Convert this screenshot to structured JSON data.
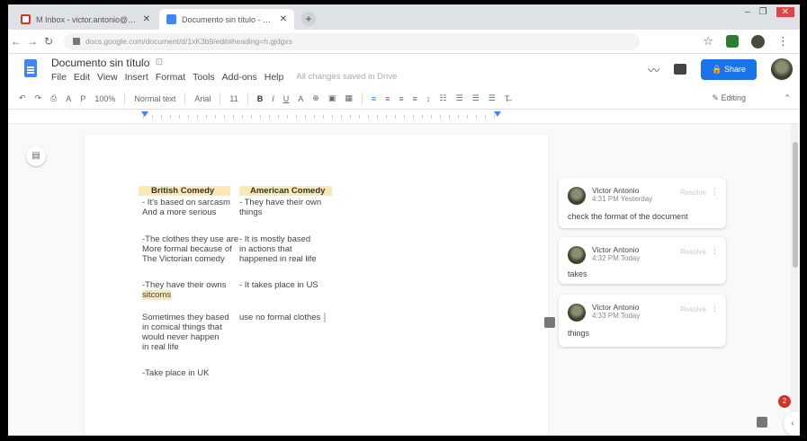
{
  "browser": {
    "tabs": [
      {
        "label": "M Inbox - victor.antonio@gmail.com",
        "active": false
      },
      {
        "label": "Documento sin título - Google Docs",
        "active": true
      }
    ],
    "new_tab": "+",
    "url": "docs.google.com/document/d/1xK3b9/edit#heading=h.gjdgxs",
    "window_controls": [
      "–",
      "❐",
      "✕"
    ]
  },
  "docs": {
    "title": "Documento sin título",
    "title_icons": "☆ ⊡",
    "menu": [
      "File",
      "Edit",
      "View",
      "Insert",
      "Format",
      "Tools",
      "Add-ons",
      "Help"
    ],
    "last_edit": "All changes saved in Drive",
    "share_label": "Share"
  },
  "toolbar": {
    "undo": "↶",
    "redo": "↷",
    "print": "⎙",
    "spell": "A",
    "paint": "P",
    "zoom": "100%",
    "style": "Normal text",
    "font": "Arial",
    "size": "11",
    "bold": "B",
    "italic": "I",
    "underline": "U",
    "color": "A",
    "link": "⊕",
    "comment": "▣",
    "image": "▦",
    "align": [
      "≡",
      "≡",
      "≡",
      "≡"
    ],
    "spacing": "↕",
    "lists": [
      "☷",
      "☰",
      "☰",
      "☰"
    ],
    "clear": "T̶",
    "editing": "Editing",
    "collapse": "⌃"
  },
  "document": {
    "col1_header": "British Comedy",
    "col2_header": "American Comedy",
    "lines_col1": [
      "- It's based on sarcasm",
      "And a more serious",
      "",
      "-The clothes they use are",
      "More formal because of",
      "The Victorian comedy",
      "",
      "-They have their owns",
      "sitcoms",
      "",
      "Sometimes they based",
      "in comical things that",
      "would never happen",
      "in real life",
      "",
      "-Take place in UK"
    ],
    "lines_col2": [
      "- They have their own",
      "things",
      "",
      "- It is mostly based",
      "in actions that",
      "happened in real life",
      "",
      "- It takes place in US",
      "",
      "",
      "use no formal clothes"
    ]
  },
  "comments": [
    {
      "name": "Victor Antonio",
      "time": "4:31 PM Yesterday",
      "resolve": "Resolve",
      "more": "⋮",
      "text": "check the format of the document"
    },
    {
      "name": "Victor Antonio",
      "time": "4:32 PM Today",
      "resolve": "Resolve",
      "more": "⋮",
      "text": "takes"
    },
    {
      "name": "Victor Antonio",
      "time": "4:33 PM Today",
      "resolve": "Resolve",
      "more": "⋮",
      "text": "things"
    }
  ],
  "badges": {
    "notifications": "2"
  },
  "icons": {
    "outline": "outline-icon",
    "side_arrow": "‹"
  }
}
